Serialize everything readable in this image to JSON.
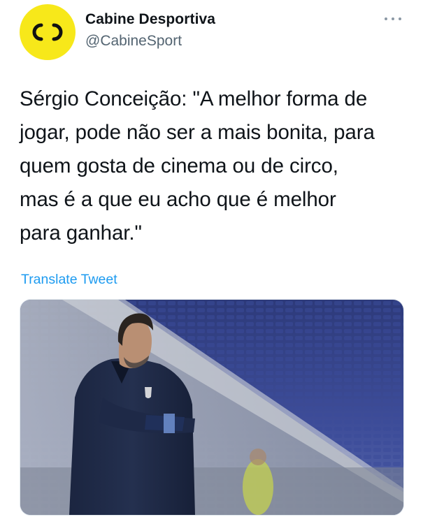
{
  "account": {
    "display_name": "Cabine Desportiva",
    "handle": "@CabineSport",
    "avatar_icon": "cd-logo-icon",
    "avatar_color": "#f7e81a"
  },
  "tweet": {
    "text": "Sérgio Conceição: \"A melhor forma de\njogar, pode não ser a mais bonita, para\nquem gosta de cinema ou de circo,\nmas é a que eu acho que é melhor\npara ganhar.\"",
    "translate_label": "Translate Tweet",
    "more_icon": "more-horizontal-icon",
    "media_description_icon": "photo-icon"
  },
  "colors": {
    "link": "#1d9bf0",
    "secondary_text": "#536471"
  }
}
